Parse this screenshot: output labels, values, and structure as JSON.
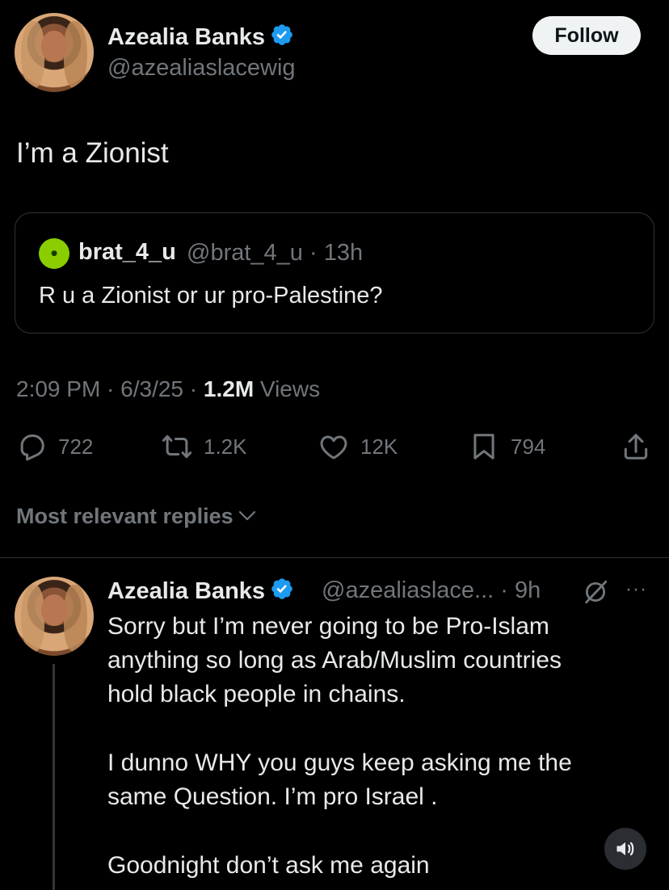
{
  "tweet": {
    "author_name": "Azealia Banks",
    "author_handle": "@azealiaslacewig",
    "follow_label": "Follow",
    "text": "I’m a Zionist",
    "quote": {
      "name": "brat_4_u",
      "handle_time": "@brat_4_u · 13h",
      "text": "R u a Zionist or ur pro-Palestine?"
    },
    "meta": {
      "time_date": "2:09 PM · 6/3/25 · ",
      "views_count": "1.2M",
      "views_label": " Views"
    },
    "actions": {
      "replies": "722",
      "reposts": "1.2K",
      "likes": "12K",
      "bookmarks": "794"
    }
  },
  "replies_header": {
    "sort_label": "Most relevant replies"
  },
  "reply": {
    "author_name": "Azealia Banks",
    "handle_time": "@azealiaslace... · 9h",
    "more": "···",
    "lines": [
      "Sorry but I’m never going to be Pro-Islam",
      "anything so long as Arab/Muslim countries",
      "hold black people in chains.",
      "I dunno WHY you guys keep asking me the",
      "same Question. I’m pro Israel .",
      "Goodnight don’t ask me again"
    ]
  },
  "colors": {
    "background": "#000000",
    "text_primary": "#e7e9ea",
    "text_secondary": "#71767b",
    "verified": "#1d9bf0",
    "divider": "#2f3336"
  },
  "icons": [
    "verified-badge-icon",
    "reply-icon",
    "repost-icon",
    "like-icon",
    "bookmark-icon",
    "share-icon",
    "chevron-down-icon",
    "grok-icon",
    "sound-icon"
  ]
}
